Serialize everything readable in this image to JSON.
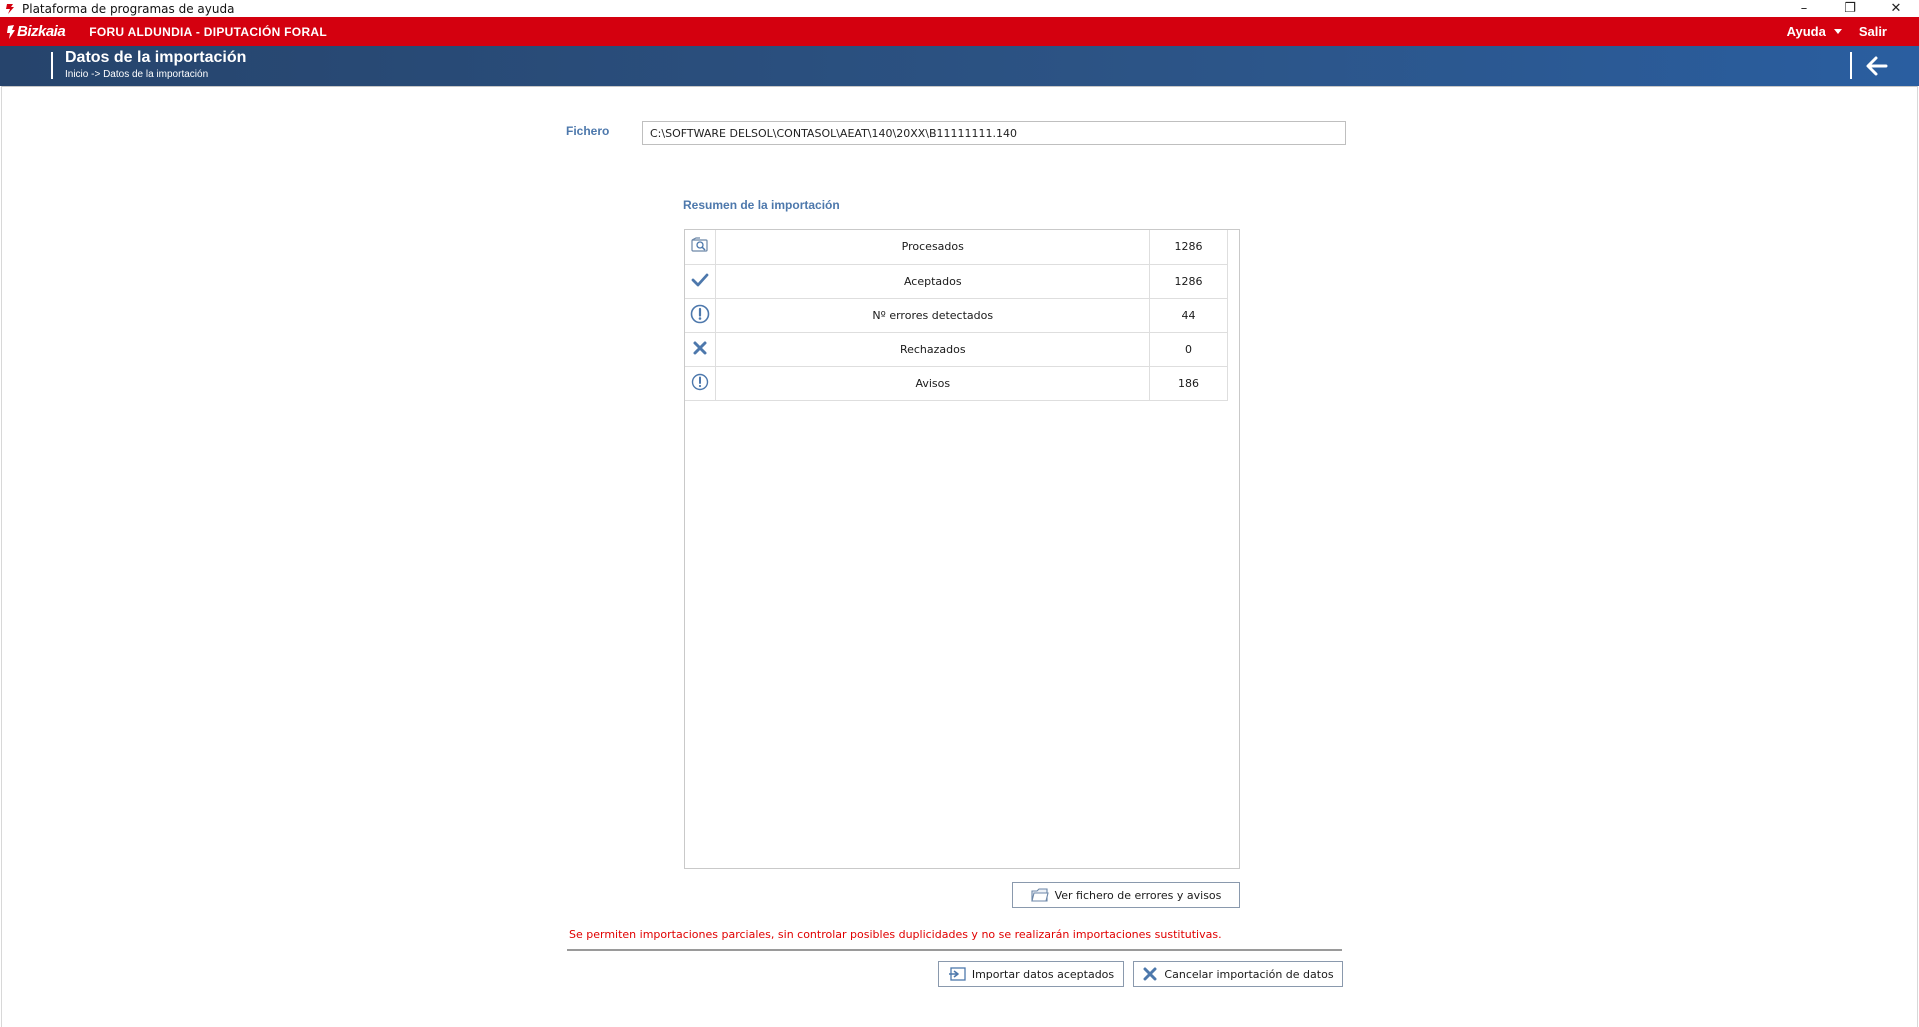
{
  "window": {
    "title": "Plataforma de programas de ayuda",
    "controls": {
      "minimize": "–",
      "restore": "❐",
      "close": "✕"
    }
  },
  "topbar": {
    "logo_text": "Bizkaia",
    "org_name": "FORU ALDUNDIA - DIPUTACIÓN FORAL",
    "help_label": "Ayuda",
    "exit_label": "Salir",
    "color": "#d4000f"
  },
  "pageheader": {
    "title": "Datos de la importación",
    "breadcrumb": "Inicio -> Datos de la importación",
    "back_icon": "arrow-left-icon"
  },
  "file": {
    "label": "Fichero",
    "value": "C:\\SOFTWARE DELSOL\\CONTASOL\\AEAT\\140\\20XX\\B11111111.140"
  },
  "summary": {
    "title": "Resumen de la importación",
    "rows": [
      {
        "icon": "search-document-icon",
        "label": "Procesados",
        "value": "1286"
      },
      {
        "icon": "checkmark-icon",
        "label": "Aceptados",
        "value": "1286"
      },
      {
        "icon": "exclamation-circle-icon",
        "label": "Nº errores detectados",
        "value": "44"
      },
      {
        "icon": "cross-icon",
        "label": "Rechazados",
        "value": "0"
      },
      {
        "icon": "warning-circle-icon",
        "label": "Avisos",
        "value": "186"
      }
    ]
  },
  "buttons": {
    "view_errors": "Ver fichero de errores y avisos",
    "import_accepted": "Importar datos aceptados",
    "cancel_import": "Cancelar importación de datos"
  },
  "warning_text": "Se permiten importaciones parciales, sin controlar posibles duplicidades y no se realizarán importaciones sustitutivas.",
  "colors": {
    "accent_blue": "#4d78ac",
    "header_blue": "#2c5486",
    "warning_red": "#e00000"
  }
}
